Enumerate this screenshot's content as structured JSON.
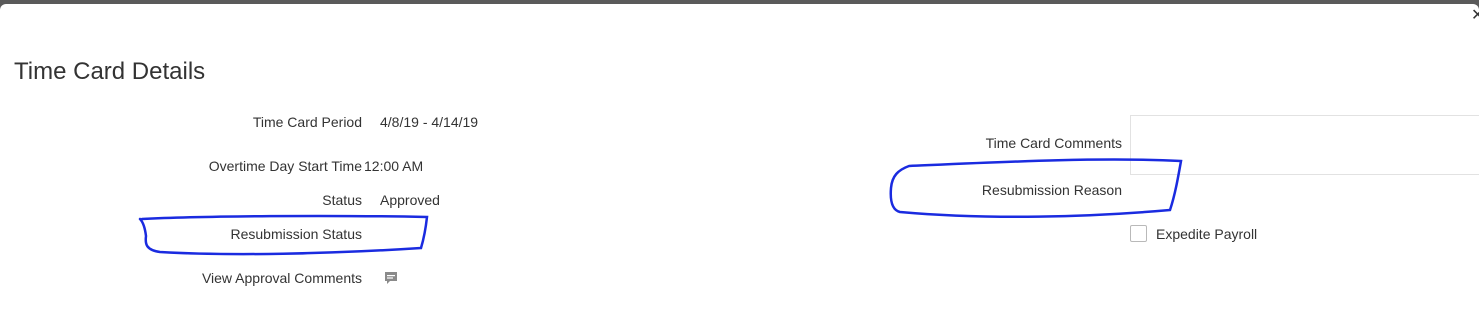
{
  "dialog": {
    "title": "Time Card Details",
    "close_glyph": "✕"
  },
  "left_fields": {
    "period_label": "Time Card Period",
    "period_value": "4/8/19 - 4/14/19",
    "overtime_label": "Overtime Day Start Time",
    "overtime_value": "12:00 AM",
    "status_label": "Status",
    "status_value": "Approved",
    "resubmission_status_label": "Resubmission Status",
    "view_approval_comments_label": "View Approval Comments",
    "comment_icon": "speech-bubble-icon"
  },
  "right_fields": {
    "comments_label": "Time Card Comments",
    "comments_value": "",
    "resubmission_reason_label": "Resubmission Reason",
    "expedite_label": "Expedite Payroll",
    "expedite_checked": false
  },
  "colors": {
    "annotation_ink": "#1a2be0",
    "overlay": "#5a5a5a"
  }
}
